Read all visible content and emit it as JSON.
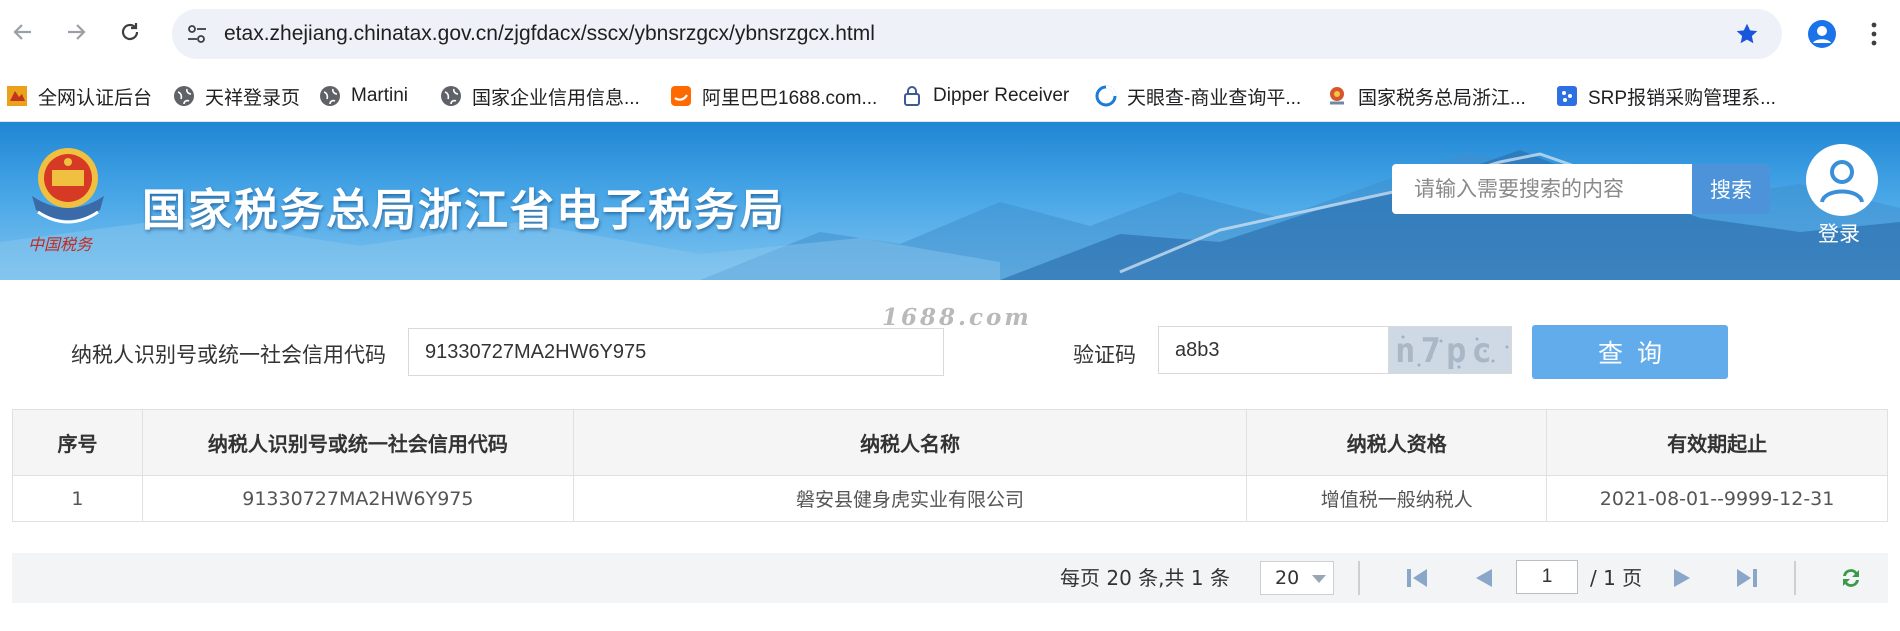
{
  "browser": {
    "url": "etax.zhejiang.chinatax.gov.cn/zjgfdacx/sscx/ybnsrzgcx/ybnsrzgcx.html",
    "bookmarks": [
      {
        "label": "全网认证后台",
        "icon": "app-icon"
      },
      {
        "label": "天祥登录页",
        "icon": "globe-icon"
      },
      {
        "label": "Martini",
        "icon": "globe-icon"
      },
      {
        "label": "国家企业信用信息...",
        "icon": "globe-icon"
      },
      {
        "label": "阿里巴巴1688.com...",
        "icon": "alibaba-icon"
      },
      {
        "label": "Dipper Receiver",
        "icon": "lock-icon"
      },
      {
        "label": "天眼查-商业查询平...",
        "icon": "tianyancha-icon"
      },
      {
        "label": "国家税务总局浙江...",
        "icon": "tax-emblem-icon"
      },
      {
        "label": "SRP报销采购管理系...",
        "icon": "srp-icon"
      }
    ]
  },
  "header": {
    "title": "国家税务总局浙江省电子税务局",
    "search_placeholder": "请输入需要搜索的内容",
    "search_button": "搜索",
    "login_label": "登录"
  },
  "form": {
    "tax_id_label": "纳税人识别号或统一社会信用代码",
    "tax_id_value": "91330727MA2HW6Y975",
    "captcha_label": "验证码",
    "captcha_value": "a8b3",
    "captcha_image_text": "n7pc",
    "query_button": "查询",
    "watermark": "1688.com"
  },
  "table": {
    "headers": [
      "序号",
      "纳税人识别号或统一社会信用代码",
      "纳税人名称",
      "纳税人资格",
      "有效期起止"
    ],
    "rows": [
      [
        "1",
        "91330727MA2HW6Y975",
        "磐安县健身虎实业有限公司",
        "增值税一般纳税人",
        "2021-08-01--9999-12-31"
      ]
    ]
  },
  "pager": {
    "summary": "每页 20 条,共 1 条",
    "page_size": "20",
    "current_page": "1",
    "total_pages": "/ 1 页"
  },
  "colors": {
    "header_blue": "#1f86d4",
    "search_button": "#4d93d9",
    "query_button": "#62acec",
    "nav_icon": "#8aa6c8"
  }
}
